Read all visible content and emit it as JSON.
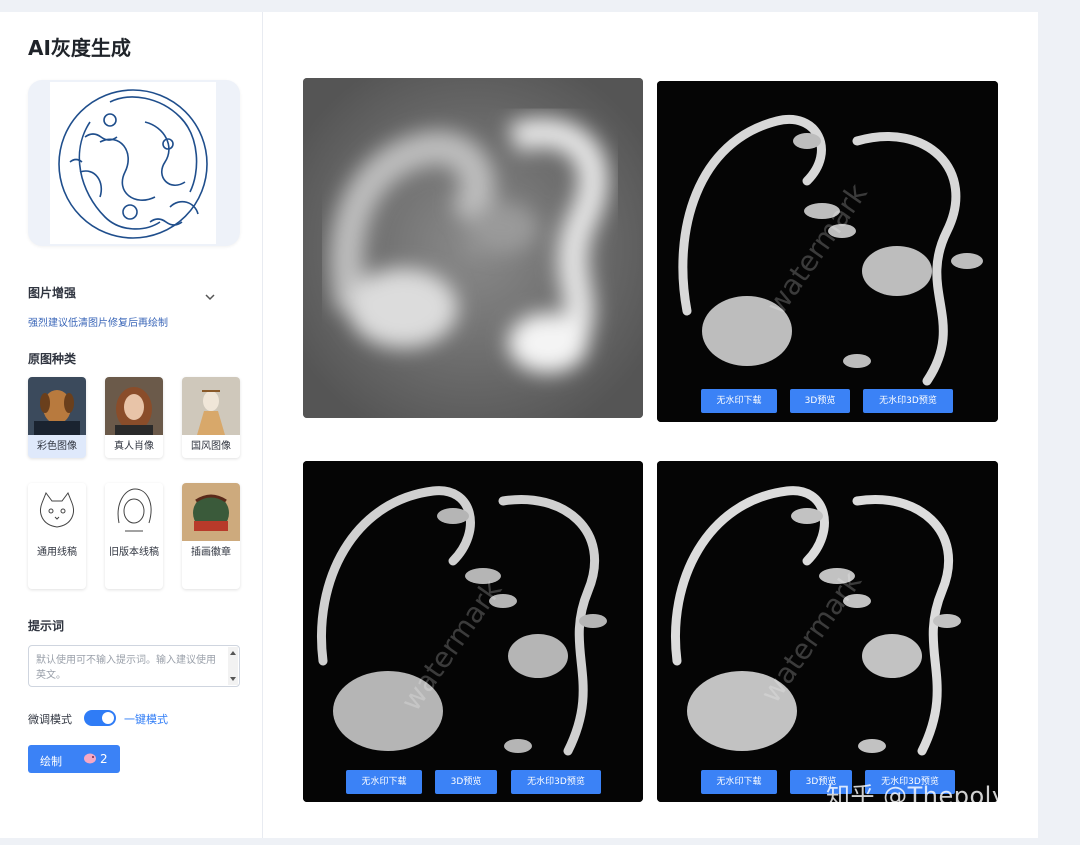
{
  "sidebar": {
    "title": "AI灰度生成",
    "enhance": {
      "label": "图片增强",
      "hint": "强烈建议低清图片修复后再绘制"
    },
    "category_label": "原图种类",
    "categories": [
      {
        "label": "彩色图像",
        "selected": true
      },
      {
        "label": "真人肖像",
        "selected": false
      },
      {
        "label": "国风图像",
        "selected": false
      },
      {
        "label": "通用线稿",
        "selected": false
      },
      {
        "label": "旧版本线稿",
        "selected": false
      },
      {
        "label": "插画徽章",
        "selected": false
      }
    ],
    "prompt": {
      "label": "提示词",
      "placeholder": "默认使用可不输入提示词。输入建议使用英文。"
    },
    "mode": {
      "left": "微调模式",
      "right": "一键模式",
      "toggle_on": true
    },
    "draw": {
      "label": "绘制",
      "credits": "2"
    }
  },
  "results": {
    "buttons": {
      "download": "无水印下载",
      "preview": "3D预览",
      "preview_nowm": "无水印3D预览"
    },
    "image_watermark": "watermark"
  },
  "site_watermark": "知乎 @Thepoly",
  "colors": {
    "accent": "#3b82f6",
    "link": "#2f7cf6"
  }
}
